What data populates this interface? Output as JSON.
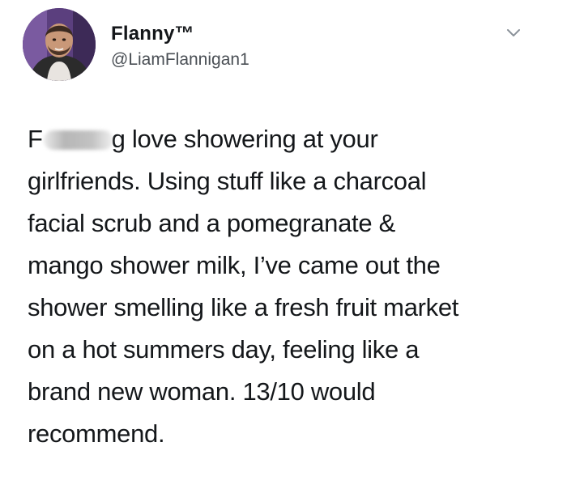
{
  "user": {
    "display_name": "Flanny™",
    "handle": "@LiamFlannigan1",
    "avatar_icon": "profile-photo"
  },
  "menu": {
    "icon": "chevron-down-icon"
  },
  "tweet": {
    "text_start": "F",
    "text_rest": "g love showering at your\ngirlfriends. Using stuff like a charcoal\nfacial scrub and a pomegranate &\nmango shower milk, I’ve came out the\nshower smelling like a fresh fruit market\non a hot summers day, feeling like a\nbrand new woman. 13/10 would\nrecommend."
  },
  "colors": {
    "text": "#14171a",
    "handle": "#4a4f55",
    "background": "#ffffff"
  }
}
